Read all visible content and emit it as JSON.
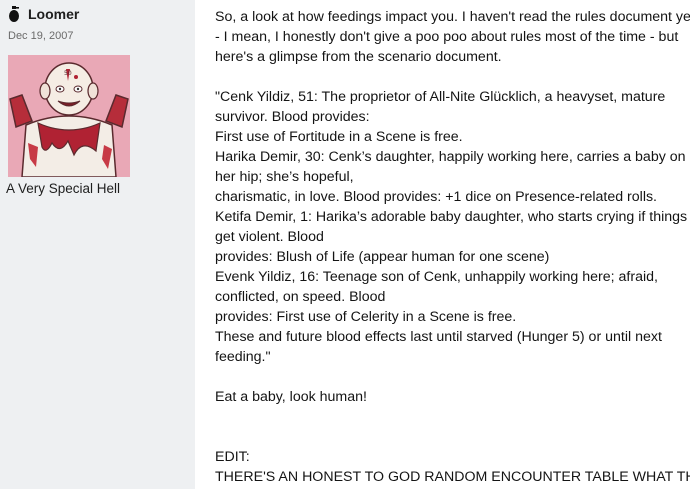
{
  "user": {
    "name": "Loomer",
    "date": "Dec 19, 2007",
    "title": "A Very Special Hell",
    "icon": "grenade-icon"
  },
  "post": {
    "lines": [
      "So, a look at how feedings impact you. I haven't read the rules document yet",
      "- I mean, I honestly don't give a poo poo about rules most of the time - but",
      "here's a glimpse from the scenario document.",
      "",
      "\"Cenk Yildiz, 51: The proprietor of All-Nite Glücklich, a heavyset, mature",
      "survivor. Blood provides:",
      "First use of Fortitude in a Scene is free.",
      "Harika Demir, 30: Cenk’s daughter, happily working here, carries a baby on",
      "her hip; she’s hopeful,",
      "charismatic, in love. Blood provides: +1 dice on Presence-related rolls.",
      "Ketifa Demir, 1: Harika’s adorable baby daughter, who starts crying if things",
      "get violent. Blood",
      "provides: Blush of Life (appear human for one scene)",
      "Evenk Yildiz, 16: Teenage son of Cenk, unhappily working here; afraid,",
      "conflicted, on speed. Blood",
      "provides: First use of Celerity in a Scene is free.",
      "These and future blood effects last until starved (Hunger 5) or until next",
      "feeding.\"",
      "",
      "Eat a baby, look human!",
      "",
      "",
      "EDIT:",
      "THERE'S AN HONEST TO GOD RANDOM ENCOUNTER TABLE WHAT THE"
    ]
  }
}
